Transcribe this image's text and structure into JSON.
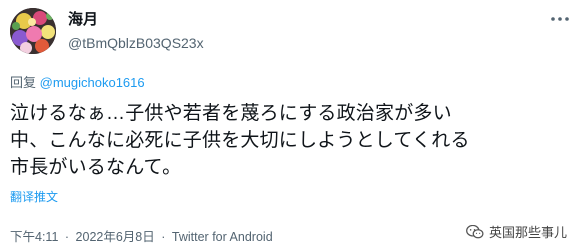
{
  "user": {
    "display_name": "海月",
    "handle": "@tBmQblzB03QS23x",
    "avatar_icon": "avatar-flowers-icon"
  },
  "reply": {
    "prefix": "回复 ",
    "mention": "@mugichoko1616"
  },
  "tweet": {
    "lines": [
      "泣けるなぁ…子供や若者を蔑ろにする政治家が多い",
      "中、こんなに必死に子供を大切にしようとしてくれる",
      "市長がいるなんて。"
    ]
  },
  "translate_label": "翻译推文",
  "meta": {
    "time": "下午4:11",
    "separator": "·",
    "date": "2022年6月8日",
    "source": "Twitter for Android"
  },
  "watermark": {
    "text": "英国那些事儿",
    "icon": "wechat-icon"
  },
  "colors": {
    "link": "#1d9bf0",
    "muted": "#536471",
    "text": "#0f1419"
  }
}
